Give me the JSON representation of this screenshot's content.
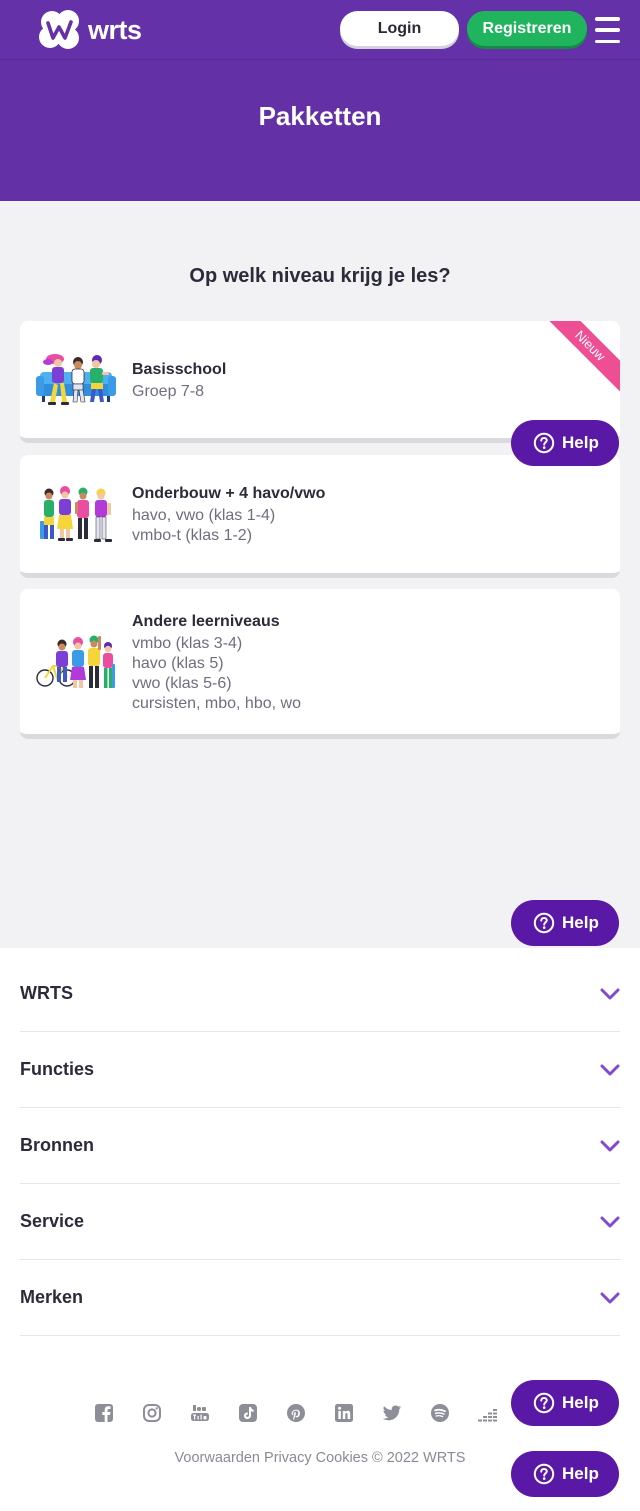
{
  "header": {
    "logo_text": "wrts",
    "login_label": "Login",
    "register_label": "Registreren",
    "menu_icon": "hamburger-menu-icon"
  },
  "hero": {
    "title": "Pakketten"
  },
  "main": {
    "question": "Op welk niveau krijg je les?",
    "cards": [
      {
        "title": "Basisschool",
        "lines": [
          "Groep 7-8"
        ],
        "badge": "Nieuw"
      },
      {
        "title": "Onderbouw + 4 havo/vwo",
        "lines": [
          "havo, vwo (klas 1-4)",
          "vmbo-t (klas 1-2)"
        ]
      },
      {
        "title": "Andere leerniveaus",
        "lines": [
          "vmbo (klas 3-4)",
          "havo (klas 5)",
          "vwo (klas 5-6)",
          "cursisten, mbo, hbo, wo"
        ]
      }
    ]
  },
  "help": {
    "label": "Help",
    "icon": "question-circle-icon"
  },
  "footer": {
    "accordion": [
      "WRTS",
      "Functies",
      "Bronnen",
      "Service",
      "Merken"
    ],
    "accordion_icon": "chevron-down-icon",
    "social": [
      "facebook-icon",
      "instagram-icon",
      "youtube-icon",
      "tiktok-icon",
      "pinterest-icon",
      "linkedin-icon",
      "twitter-icon",
      "spotify-icon",
      "deezer-icon"
    ],
    "links": [
      "Voorwaarden",
      "Privacy",
      "Cookies"
    ],
    "copyright": "© 2022 WRTS"
  },
  "colors": {
    "brand": "#6431a8",
    "hero": "#6330a5",
    "green": "#21b45f",
    "help": "#5a18a6",
    "pink": "#ee4e93",
    "chev": "#8048d4",
    "grey": "#f2f2f4"
  }
}
